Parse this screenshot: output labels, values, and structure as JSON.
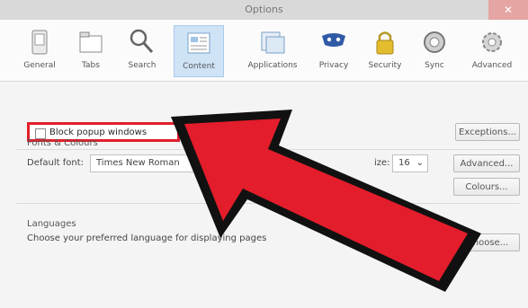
{
  "window": {
    "title": "Options",
    "close_glyph": "✕"
  },
  "toolbar": {
    "items": [
      {
        "label": "General",
        "icon": "general-icon"
      },
      {
        "label": "Tabs",
        "icon": "tabs-icon"
      },
      {
        "label": "Search",
        "icon": "search-icon"
      },
      {
        "label": "Content",
        "icon": "content-icon",
        "active": true
      },
      {
        "label": "Applications",
        "icon": "applications-icon"
      },
      {
        "label": "Privacy",
        "icon": "privacy-icon"
      },
      {
        "label": "Security",
        "icon": "security-icon"
      },
      {
        "label": "Sync",
        "icon": "sync-icon"
      },
      {
        "label": "Advanced",
        "icon": "advanced-icon"
      }
    ]
  },
  "content": {
    "block_popups_label": "Block popup windows",
    "exceptions_button": "Exceptions...",
    "fonts_section": "Fonts & Colours",
    "default_font_label": "Default font:",
    "default_font_value": "Times New Roman",
    "size_value": "16",
    "size_label": "ize:",
    "advanced_button": "Advanced...",
    "colours_button": "Colours...",
    "languages_section": "Languages",
    "languages_text": "Choose your preferred language for displaying pages",
    "choose_button": "Choose..."
  },
  "colors": {
    "highlight_red": "#e21f2b",
    "active_tab": "#cfe3f7"
  }
}
